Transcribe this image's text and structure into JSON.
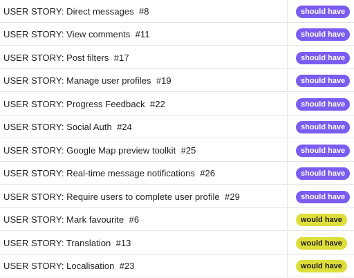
{
  "rows": [
    {
      "title": "USER STORY: Direct messages  #8",
      "label": "should have",
      "label_kind": "should"
    },
    {
      "title": "USER STORY: View comments  #11",
      "label": "should have",
      "label_kind": "should"
    },
    {
      "title": "USER STORY: Post filters  #17",
      "label": "should have",
      "label_kind": "should"
    },
    {
      "title": "USER STORY: Manage user profiles  #19",
      "label": "should have",
      "label_kind": "should"
    },
    {
      "title": "USER STORY: Progress Feedback  #22",
      "label": "should have",
      "label_kind": "should"
    },
    {
      "title": "USER STORY: Social Auth  #24",
      "label": "should have",
      "label_kind": "should"
    },
    {
      "title": "USER STORY: Google Map preview toolkit  #25",
      "label": "should have",
      "label_kind": "should"
    },
    {
      "title": "USER STORY: Real-time message notifications  #26",
      "label": "should have",
      "label_kind": "should"
    },
    {
      "title": "USER STORY: Require users to complete user profile  #29",
      "label": "should have",
      "label_kind": "should"
    },
    {
      "title": "USER STORY: Mark favourite  #6",
      "label": "would have",
      "label_kind": "would"
    },
    {
      "title": "USER STORY: Translation  #13",
      "label": "would have",
      "label_kind": "would"
    },
    {
      "title": "USER STORY: Localisation  #23",
      "label": "would have",
      "label_kind": "would"
    }
  ],
  "colors": {
    "should_have": "#7b5cf0",
    "would_have": "#dede3a"
  }
}
